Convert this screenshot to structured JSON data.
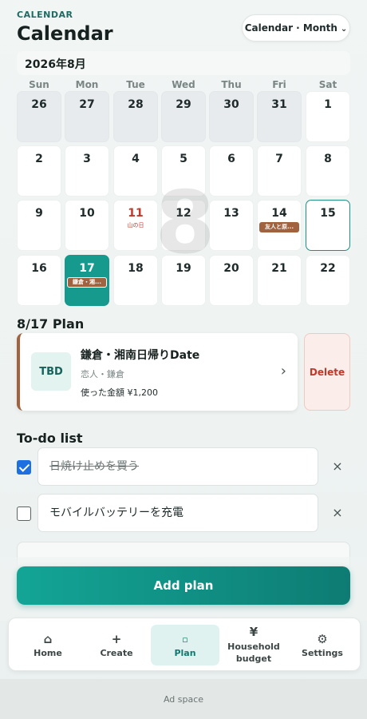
{
  "header": {
    "eyebrow": "CALENDAR",
    "title": "Calendar",
    "view_select": "Calendar · Month",
    "view_chevron_icon": "chevron-down-icon"
  },
  "calendar": {
    "month_label": "2026年8月",
    "weekdays": [
      "Sun",
      "Mon",
      "Tue",
      "Wed",
      "Thu",
      "Fri",
      "Sat"
    ],
    "watermark": "8",
    "weeks": [
      [
        {
          "day": "26",
          "out": true
        },
        {
          "day": "27",
          "out": true
        },
        {
          "day": "28",
          "out": true
        },
        {
          "day": "29",
          "out": true
        },
        {
          "day": "30",
          "out": true
        },
        {
          "day": "31",
          "out": true
        },
        {
          "day": "1"
        }
      ],
      [
        {
          "day": "2"
        },
        {
          "day": "3"
        },
        {
          "day": "4"
        },
        {
          "day": "5"
        },
        {
          "day": "6"
        },
        {
          "day": "7"
        },
        {
          "day": "8"
        }
      ],
      [
        {
          "day": "9"
        },
        {
          "day": "10"
        },
        {
          "day": "11",
          "holiday": "山の日"
        },
        {
          "day": "12"
        },
        {
          "day": "13"
        },
        {
          "day": "14",
          "event": "友人と原..."
        },
        {
          "day": "15",
          "today": true
        }
      ],
      [
        {
          "day": "16"
        },
        {
          "day": "17",
          "selected": true,
          "event": "鎌倉・湘..."
        },
        {
          "day": "18"
        },
        {
          "day": "19"
        },
        {
          "day": "20"
        },
        {
          "day": "21"
        },
        {
          "day": "22"
        }
      ]
    ],
    "event_color": "#a0623f",
    "accent_color": "#159a8d",
    "holiday_color": "#c0392b"
  },
  "plan": {
    "section_title": "8/17 Plan",
    "thumb": "TBD",
    "title": "鎌倉・湘南日帰りDate",
    "subtitle": "恋人・鎌倉",
    "spent": "使った金額 ¥1,200",
    "chevron_icon": "chevron-right-icon",
    "delete_label": "Delete"
  },
  "todo": {
    "section_title": "To-do list",
    "items": [
      {
        "text": "日焼け止めを買う",
        "checked": true
      },
      {
        "text": "モバイルバッテリーを充電",
        "checked": false
      }
    ],
    "remove_icon": "close-icon"
  },
  "add_plan_label": "Add plan",
  "tabs": [
    {
      "label": "Home",
      "icon": "⌂",
      "icon_name": "home-icon"
    },
    {
      "label": "Create",
      "icon": "+",
      "icon_name": "plus-icon"
    },
    {
      "label": "Plan",
      "icon": "▫",
      "icon_name": "plan-icon",
      "active": true
    },
    {
      "label": "Household budget",
      "icon": "¥",
      "icon_name": "yen-icon"
    },
    {
      "label": "Settings",
      "icon": "⚙",
      "icon_name": "gear-icon"
    }
  ],
  "ad_label": "Ad space"
}
